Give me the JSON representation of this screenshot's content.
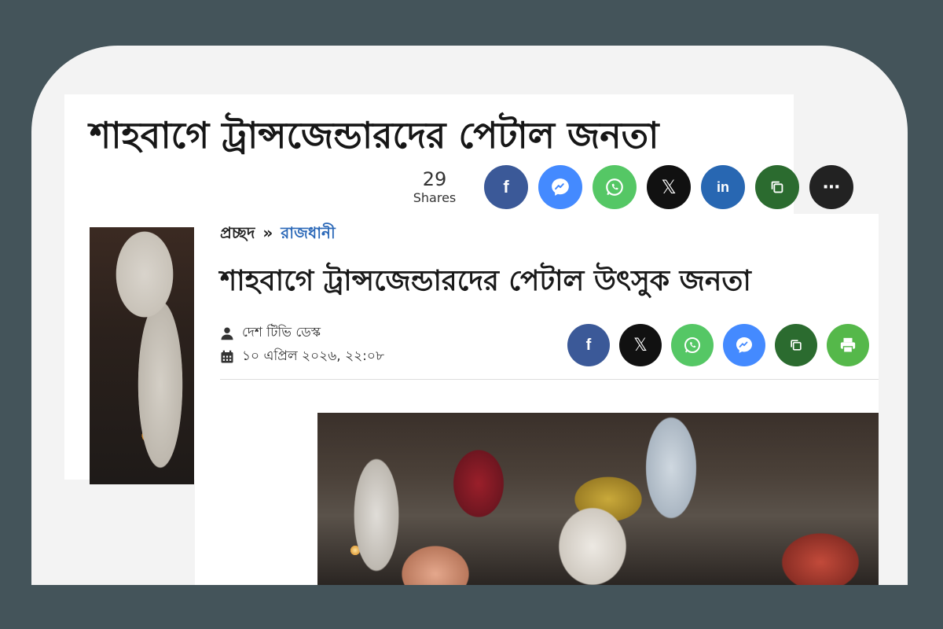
{
  "back_article": {
    "title": "শাহবাগে ট্রান্সজেন্ডারদের পেটাল জনতা",
    "shares_count": "29",
    "shares_label": "Shares",
    "share_buttons": [
      {
        "name": "facebook",
        "icon": "facebook-icon",
        "color": "#3b5998"
      },
      {
        "name": "messenger",
        "icon": "messenger-icon",
        "color": "#448aff"
      },
      {
        "name": "whatsapp",
        "icon": "whatsapp-icon",
        "color": "#55c765"
      },
      {
        "name": "x",
        "icon": "x-icon",
        "color": "#111111"
      },
      {
        "name": "linkedin",
        "icon": "linkedin-icon",
        "color": "#2867b2"
      },
      {
        "name": "copy",
        "icon": "copy-icon",
        "color": "#2b6b2f"
      },
      {
        "name": "more",
        "icon": "more-icon",
        "color": "#222222"
      }
    ]
  },
  "front_article": {
    "breadcrumb": {
      "home": "প্রচ্ছদ",
      "separator": "»",
      "category": "রাজধানী"
    },
    "title": "শাহবাগে ট্রান্সজেন্ডারদের পেটাল উৎসুক জনতা",
    "author": "দেশ টিভি ডেস্ক",
    "date": "১০ এপ্রিল ২০২৬, ২২:০৮",
    "share_buttons": [
      {
        "name": "facebook",
        "icon": "facebook-icon",
        "color": "#3b5998"
      },
      {
        "name": "x",
        "icon": "x-icon",
        "color": "#111111"
      },
      {
        "name": "whatsapp",
        "icon": "whatsapp-icon",
        "color": "#55c765"
      },
      {
        "name": "messenger",
        "icon": "messenger-icon",
        "color": "#448aff"
      },
      {
        "name": "copy",
        "icon": "copy-icon",
        "color": "#2b6b2f"
      },
      {
        "name": "print",
        "icon": "print-icon",
        "color": "#55b84a"
      }
    ]
  },
  "colors": {
    "background": "#44545a",
    "card": "#f3f3f3",
    "category_link": "#2c69b8"
  }
}
